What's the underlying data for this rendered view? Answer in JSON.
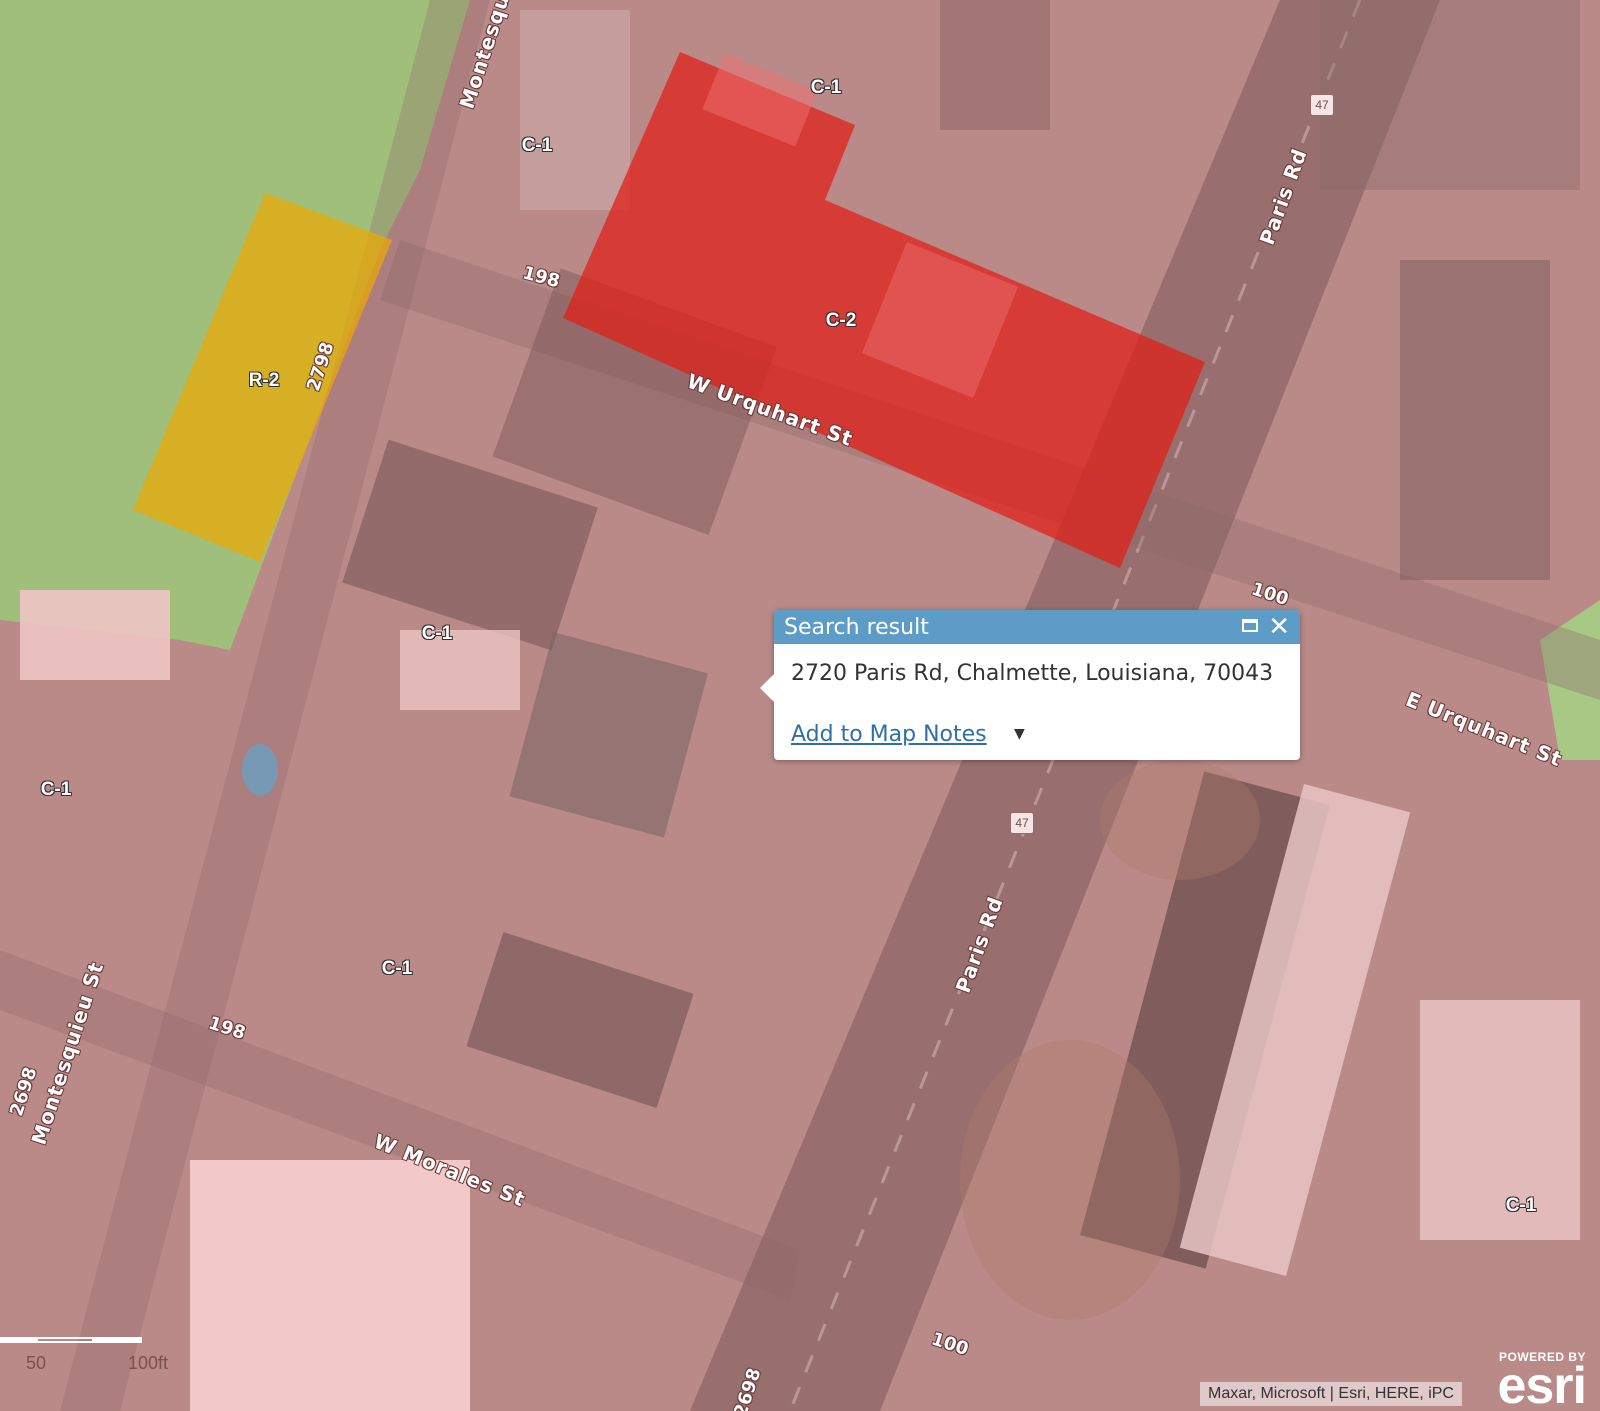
{
  "map": {
    "zone_labels": [
      "C-1",
      "C-1",
      "C-2",
      "R-2",
      "C-1",
      "C-1",
      "C-1",
      "C-1"
    ],
    "street_labels": [
      "Montesquieu",
      "Paris Rd",
      "W Urquhart St",
      "E Urquhart St",
      "Paris Rd",
      "Montesquieu St",
      "W Morales St"
    ],
    "house_numbers": [
      "198",
      "2798",
      "100",
      "198",
      "2698",
      "100",
      "2698"
    ],
    "route_shields": [
      "47",
      "47"
    ],
    "colors": {
      "commercial_c1": "#d98c8c",
      "commercial_c2": "#e0201a",
      "residential_r2": "#f0a800",
      "other_zone": "#c8e0a0",
      "popup_header": "#5d9cc6"
    }
  },
  "popup": {
    "title": "Search result",
    "address": "2720 Paris Rd, Chalmette, Louisiana, 70043",
    "add_to_notes": "Add to Map Notes",
    "caret": "▼"
  },
  "scalebar": {
    "label_left": "50",
    "label_right": "100ft"
  },
  "attribution": "Maxar, Microsoft | Esri, HERE, iPC",
  "esri": {
    "powered_by": "POWERED BY",
    "logo": "esri"
  }
}
